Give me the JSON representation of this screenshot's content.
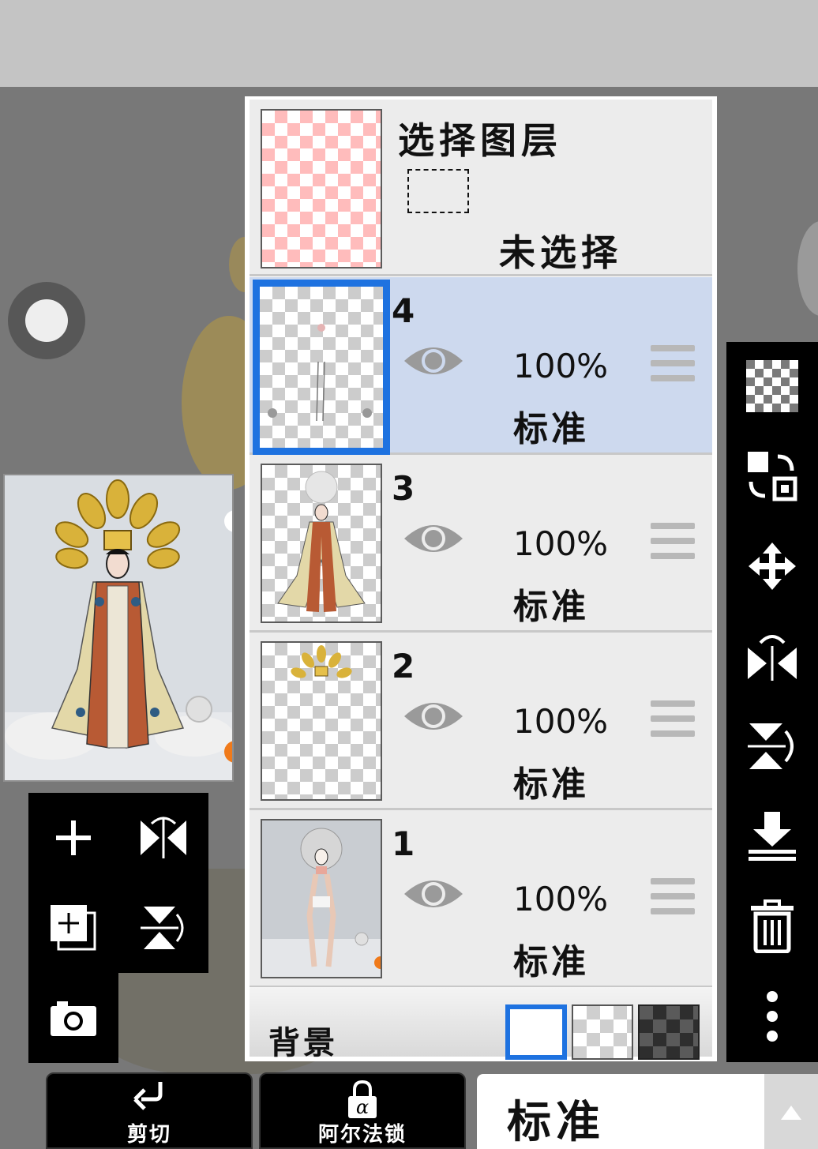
{
  "selection": {
    "title": "选择图层",
    "status": "未选择"
  },
  "layers": [
    {
      "name": "4",
      "opacity": "100%",
      "blend": "标准",
      "selected": true
    },
    {
      "name": "3",
      "opacity": "100%",
      "blend": "标准",
      "selected": false
    },
    {
      "name": "2",
      "opacity": "100%",
      "blend": "标准",
      "selected": false
    },
    {
      "name": "1",
      "opacity": "100%",
      "blend": "标准",
      "selected": false
    }
  ],
  "background": {
    "label": "背景"
  },
  "bottom_bar": {
    "clip_label": "剪切",
    "alpha_lock_label": "阿尔法锁",
    "blend_mode_value": "标准"
  },
  "icons": {
    "left_tools": [
      "add-layer-icon",
      "flip-horizontal-icon",
      "duplicate-layer-icon",
      "flip-vertical-icon",
      "camera-icon"
    ],
    "right_tools": [
      "transparency-icon",
      "swap-icon",
      "move-icon",
      "flip-horizontal-icon",
      "flip-vertical-icon",
      "merge-down-icon",
      "delete-icon",
      "more-icon"
    ]
  },
  "colors": {
    "selected_layer_bg": "#cdd9ee",
    "selection_accent": "#1e72e0",
    "panel_bg": "#ececec",
    "toolbar_bg": "#000000"
  }
}
